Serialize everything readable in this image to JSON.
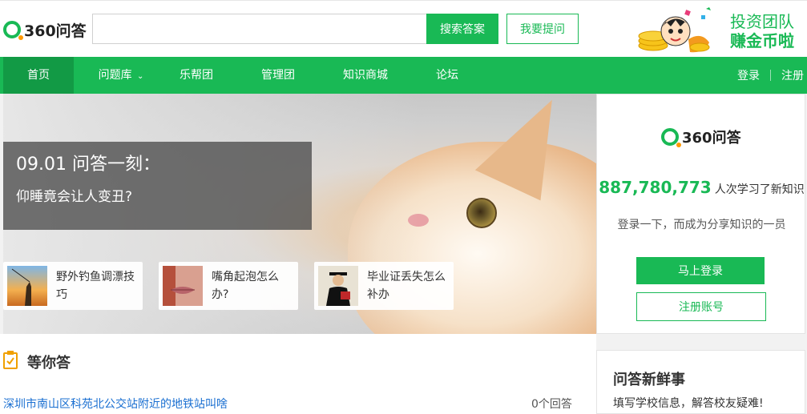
{
  "header": {
    "logo_text": "360问答",
    "search_value": "",
    "search_placeholder": "",
    "search_button": "搜索答案",
    "ask_button": "我要提问",
    "promo_line1": "投资团队",
    "promo_line2": "赚金币啦"
  },
  "nav": {
    "items": [
      {
        "label": "首页"
      },
      {
        "label": "问题库"
      },
      {
        "label": "乐帮团"
      },
      {
        "label": "管理团"
      },
      {
        "label": "知识商城"
      },
      {
        "label": "论坛"
      }
    ],
    "login": "登录",
    "register": "注册"
  },
  "banner": {
    "title": "09.01 问答一刻：",
    "subtitle": "仰睡竟会让人变丑?",
    "cards": [
      {
        "label": "野外钓鱼调漂技巧"
      },
      {
        "label": "嘴角起泡怎么办?"
      },
      {
        "label": "毕业证丢失怎么补办"
      }
    ]
  },
  "side": {
    "logo_text": "360问答",
    "count": "887,780,773",
    "count_suffix": "人次学习了新知识",
    "tip": "登录一下，而成为分享知识的一员",
    "login_button": "马上登录",
    "register_button": "注册账号"
  },
  "waiting": {
    "title": "等你答",
    "question": "深圳市南山区科苑北公交站附近的地铁站叫啥",
    "answers": "0个回答"
  },
  "news": {
    "title": "问答新鲜事",
    "line": "填写学校信息，解答校友疑难!"
  },
  "colors": {
    "brand": "#19b955",
    "nav_active": "#129a45",
    "link": "#1a6fd1"
  }
}
